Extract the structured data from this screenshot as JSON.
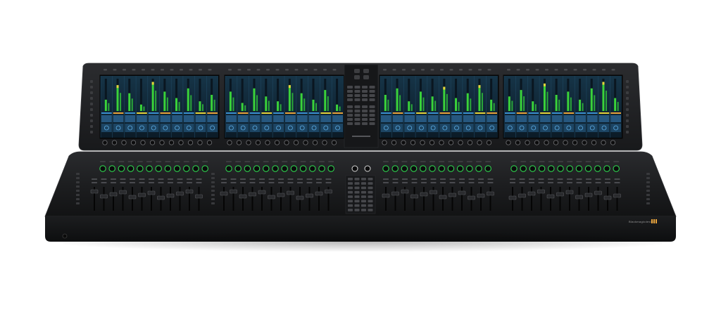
{
  "product": {
    "brand_label": "Blackmagicdesign",
    "colors": {
      "body": "#1b1c1e",
      "body_edge": "#2b2c2f",
      "screen_bg": "#0e2230",
      "meter_green": "#3ad33a",
      "meter_yellow": "#e6d23a",
      "meter_red": "#e03a2a",
      "knob_ring": "#2fd24f",
      "channel_blue": "#2f6a9a",
      "accent_orange": "#e8a23a"
    },
    "screens": [
      {
        "channels": 10
      },
      {
        "channels": 10
      },
      {
        "channels": 10
      },
      {
        "channels": 10
      }
    ],
    "fader_banks": [
      {
        "faders": 12
      },
      {
        "faders": 12
      },
      {
        "faders": 12
      },
      {
        "faders": 12
      }
    ],
    "meter_levels": [
      [
        0.35,
        0.8,
        0.55,
        0.2,
        0.9,
        0.6,
        0.4,
        0.7,
        0.3,
        0.5
      ],
      [
        0.6,
        0.25,
        0.7,
        0.45,
        0.3,
        0.8,
        0.55,
        0.35,
        0.65,
        0.2
      ],
      [
        0.5,
        0.7,
        0.3,
        0.6,
        0.45,
        0.75,
        0.4,
        0.55,
        0.8,
        0.35
      ],
      [
        0.45,
        0.65,
        0.3,
        0.85,
        0.5,
        0.6,
        0.35,
        0.7,
        0.9,
        0.4
      ]
    ]
  }
}
